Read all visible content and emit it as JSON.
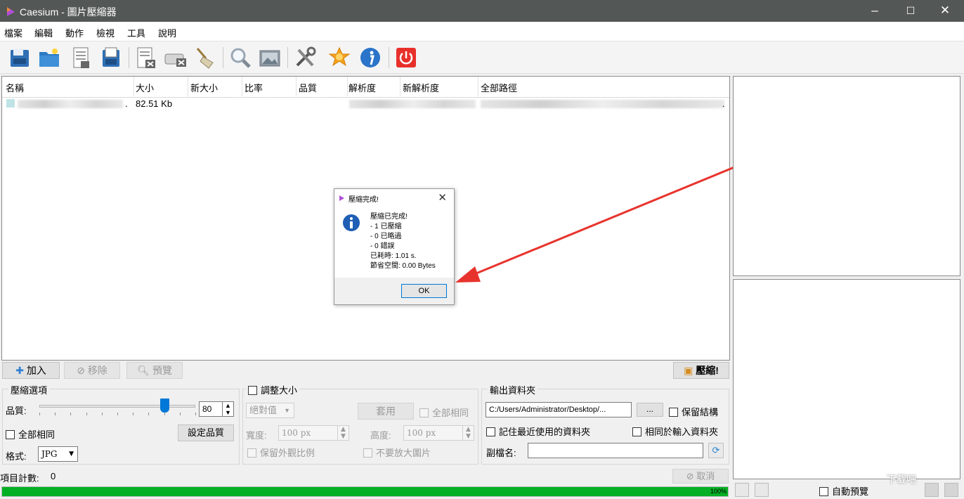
{
  "window": {
    "title": "Caesium - 圖片壓縮器",
    "minimize": "–",
    "maximize": "☐",
    "close": "✕"
  },
  "menu": [
    "檔案",
    "編輯",
    "動作",
    "檢視",
    "工具",
    "說明"
  ],
  "toolbar": [
    "open-file",
    "open-folder",
    "save-list",
    "open-list",
    "remove-item",
    "clear-list",
    "clean",
    "preview",
    "compare",
    "settings",
    "update-check",
    "about",
    "exit"
  ],
  "list": {
    "columns": [
      "名稱",
      "大小",
      "新大小",
      "比率",
      "品質",
      "解析度",
      "新解析度",
      "全部路徑"
    ],
    "rows": [
      {
        "name_suffix": ".",
        "size": "82.51 Kb",
        "path_suffix": "."
      }
    ]
  },
  "dialog": {
    "title": "壓縮完成!",
    "lines": [
      "壓縮已完成!",
      "- 1 已壓縮",
      "- 0 已略過",
      "- 0 錯誤",
      "已耗時:  1.01 s.",
      "節省空間:  0.00 Bytes"
    ],
    "ok": "OK"
  },
  "actions": {
    "add": "加入",
    "remove": "移除",
    "preview": "預覽",
    "compress": "壓縮!"
  },
  "compression": {
    "title": "壓縮選項",
    "quality_label": "品質:",
    "quality": 80,
    "same_all": "全部相同",
    "set_quality": "設定品質",
    "format_label": "格式:",
    "format": "JPG"
  },
  "resize": {
    "title": "調整大小",
    "mode": "絕對值",
    "apply": "套用",
    "same_all": "全部相同",
    "width_label": "寬度:",
    "width": "100 px",
    "height_label": "高度:",
    "height": "100 px",
    "keep_ratio": "保留外觀比例",
    "no_enlarge": "不要放大圖片"
  },
  "output": {
    "title": "輸出資料夾",
    "path": "C:/Users/Administrator/Desktop/...",
    "browse": "...",
    "keep_structure": "保留結構",
    "remember": "記住最近使用的資料夾",
    "same_as_input": "相同於輸入資料夾",
    "suffix_label": "副檔名:",
    "suffix": ""
  },
  "status": {
    "item_count_label": "項目計數:",
    "item_count": "0",
    "cancel": "取消",
    "progress": 100,
    "progress_text": "100%"
  },
  "preview_panel": {
    "auto_preview": "自動預覽",
    "watermark": "下载吧"
  }
}
